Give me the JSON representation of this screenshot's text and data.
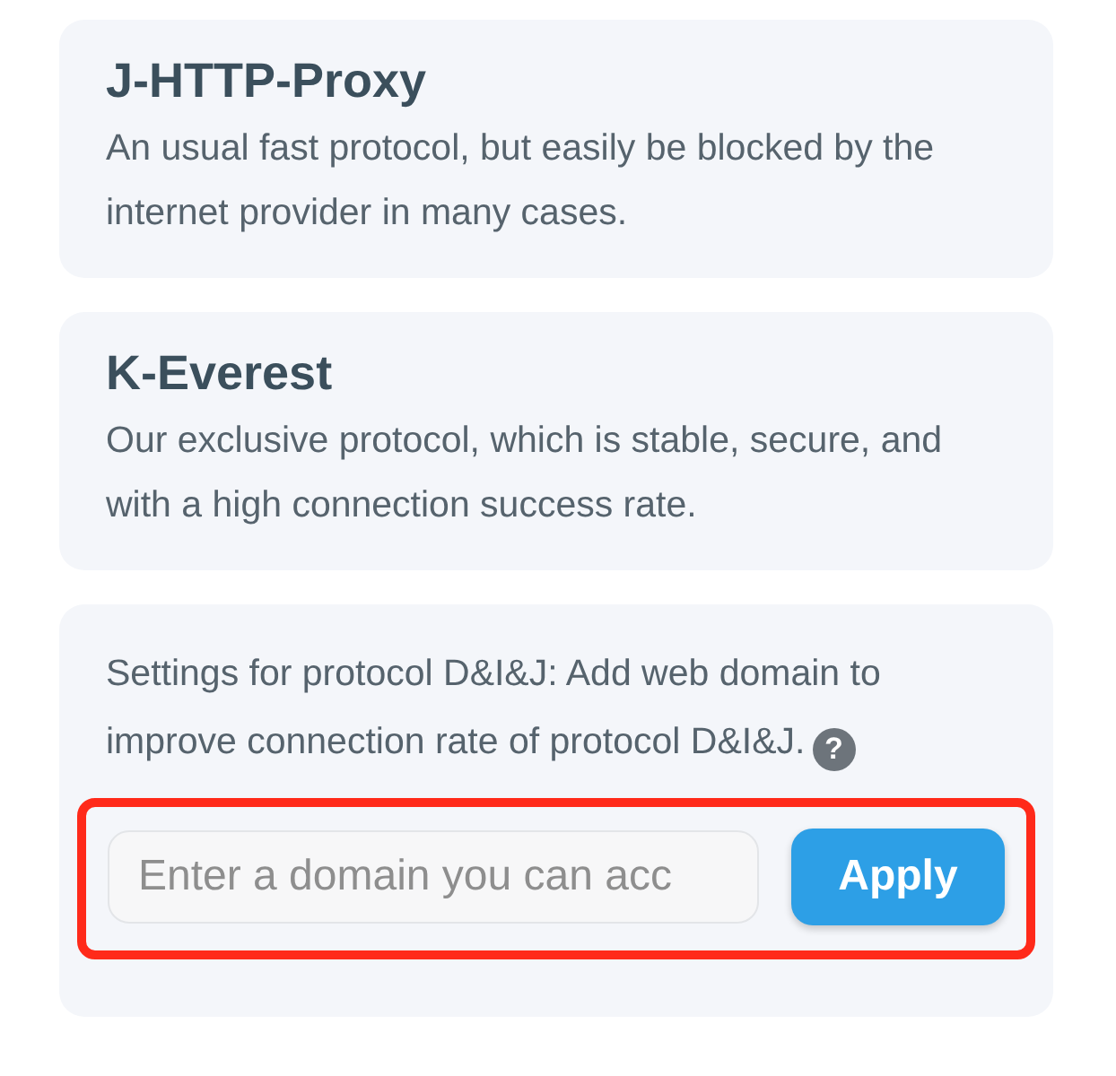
{
  "protocols": [
    {
      "title": "J-HTTP-Proxy",
      "description": "An usual fast protocol, but easily be blocked by the internet provider in many cases."
    },
    {
      "title": "K-Everest",
      "description": "Our exclusive protocol, which is stable, secure, and with a high connection success rate."
    }
  ],
  "settings": {
    "text": "Settings for protocol D&I&J: Add web domain to improve connection rate of protocol D&I&J.",
    "help_icon": "?",
    "domain_field": {
      "placeholder": "Enter a domain you can acc"
    },
    "apply_button": "Apply",
    "highlighted": true
  }
}
